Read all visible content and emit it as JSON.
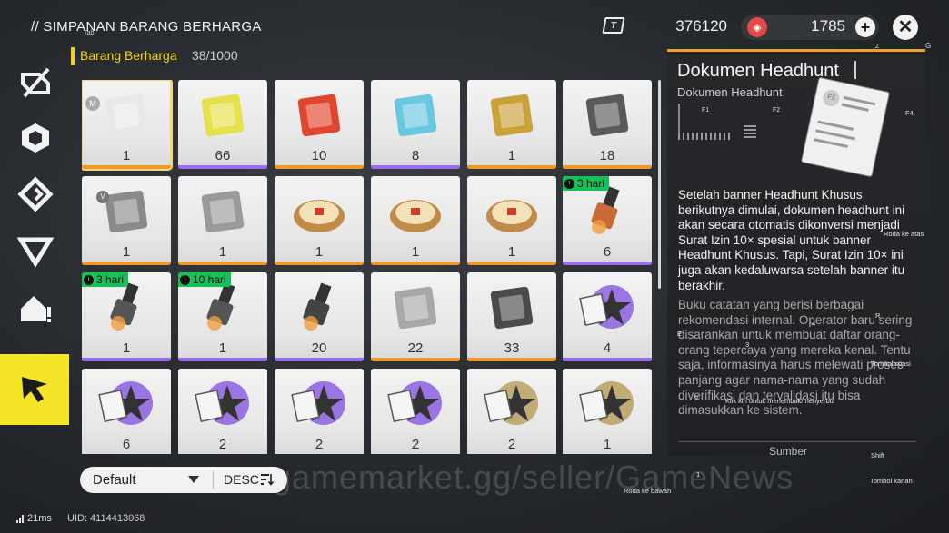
{
  "header": {
    "title": "// SIMPANAN BARANG BERHARGA",
    "tab_hint": "Tab",
    "currency1": {
      "icon": "tech-chip-icon",
      "value": "376120"
    },
    "currency2": {
      "icon": "polychrome-icon",
      "value": "1785"
    },
    "plus_label": "+",
    "close_label": "✕",
    "key_z": "Z",
    "key_g": "G"
  },
  "category": {
    "label": "Barang Berharga",
    "count": "38/1000"
  },
  "items": [
    {
      "qty": "1",
      "rarity": "orange",
      "art": "document",
      "selected": true,
      "badge": "M",
      "timer": ""
    },
    {
      "qty": "66",
      "rarity": "purple",
      "art": "ticket",
      "timer": ""
    },
    {
      "qty": "10",
      "rarity": "orange",
      "art": "red-crystal",
      "timer": ""
    },
    {
      "qty": "8",
      "rarity": "purple",
      "art": "blue-cube",
      "timer": ""
    },
    {
      "qty": "1",
      "rarity": "orange",
      "art": "poster",
      "timer": ""
    },
    {
      "qty": "18",
      "rarity": "orange",
      "art": "cage-cube",
      "timer": ""
    },
    {
      "qty": "1",
      "rarity": "orange",
      "art": "gray-box",
      "badge_v": "V",
      "timer": ""
    },
    {
      "qty": "1",
      "rarity": "orange",
      "art": "gray-box2",
      "timer": ""
    },
    {
      "qty": "1",
      "rarity": "orange",
      "art": "bun",
      "timer": ""
    },
    {
      "qty": "1",
      "rarity": "orange",
      "art": "bun",
      "timer": ""
    },
    {
      "qty": "1",
      "rarity": "orange",
      "art": "bun",
      "timer": ""
    },
    {
      "qty": "6",
      "rarity": "purple",
      "art": "flame-canister",
      "timer": "3 hari"
    },
    {
      "qty": "1",
      "rarity": "purple",
      "art": "spark-plug",
      "timer": "3 hari"
    },
    {
      "qty": "1",
      "rarity": "purple",
      "art": "spark-plug",
      "timer": "10 hari"
    },
    {
      "qty": "20",
      "rarity": "purple",
      "art": "spark-plug2",
      "timer": ""
    },
    {
      "qty": "22",
      "rarity": "orange",
      "art": "metal-stand",
      "timer": ""
    },
    {
      "qty": "33",
      "rarity": "orange",
      "art": "disc",
      "timer": ""
    },
    {
      "qty": "4",
      "rarity": "purple",
      "art": "purple-star-card",
      "timer": ""
    },
    {
      "qty": "6",
      "rarity": "purple",
      "art": "purple-star-card",
      "timer": ""
    },
    {
      "qty": "2",
      "rarity": "purple",
      "art": "purple-star-card",
      "timer": ""
    },
    {
      "qty": "2",
      "rarity": "purple",
      "art": "purple-star-card",
      "timer": ""
    },
    {
      "qty": "2",
      "rarity": "purple",
      "art": "purple-star-card",
      "timer": ""
    },
    {
      "qty": "2",
      "rarity": "gold",
      "art": "gold-star-card",
      "timer": ""
    },
    {
      "qty": "1",
      "rarity": "gold",
      "art": "gold-star-card",
      "timer": ""
    }
  ],
  "sort": {
    "value": "Default",
    "order": "DESC"
  },
  "watermark": "gamemarket.gg/seller/GameNews",
  "detail": {
    "title": "Dokumen Headhunt",
    "subtitle": "Dokumen Headhunt",
    "f1": "F1",
    "f2": "F2",
    "f3": "F3",
    "f4": "F4",
    "description": "Setelah banner Headhunt Khusus berikutnya dimulai, dokumen headhunt ini akan secara otomatis dikonversi menjadi Surat Izin 10× spesial untuk banner Headhunt Khusus. Tapi, Surat Izin 10× ini juga akan kedaluwarsa setelah banner itu berakhir.",
    "flavor": "Buku catatan yang berisi berbagai rekomendasi internal. Operator baru sering disarankan untuk membuat daftar orang-orang tepercaya yang mereka kenal. Tentu saja, informasinya harus melewati proses panjang agar nama-nama yang sudah diverifikasi dan tervalidasi itu bisa dimasukkan ke sistem.",
    "bottom": "Sumber"
  },
  "hints": {
    "roda_atas": "Roda ke atas",
    "r": "R",
    "four": "4",
    "e": "E",
    "three": "3",
    "tombol_spasi": "Tombol spasi",
    "two": "2",
    "klik_kiri": "Klik kiri untuk menembak/menyerbu",
    "shift": "Shift",
    "one": "1",
    "tombol_kanan": "Tombol kanan",
    "roda_bawah": "Roda ke bawah"
  },
  "status": {
    "ping": "21ms",
    "uid": "UID: 4114413068"
  },
  "colors": {
    "accent_yellow": "#f5e529",
    "timer_green": "#19c05a",
    "rarity_orange": "#f0982a",
    "rarity_purple": "#9b6cf0",
    "rarity_gold": "#e8c040"
  }
}
